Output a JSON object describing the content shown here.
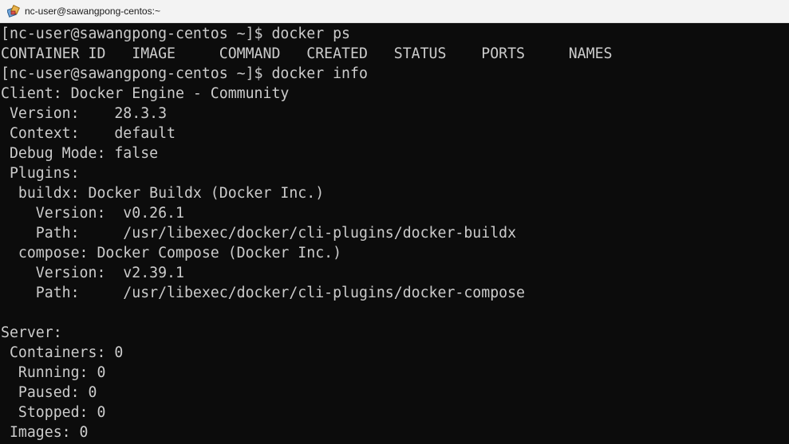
{
  "window": {
    "title": "nc-user@sawangpong-centos:~",
    "icon": "putty-terminal-icon"
  },
  "terminal": {
    "lines": [
      "[nc-user@sawangpong-centos ~]$ docker ps",
      "CONTAINER ID   IMAGE     COMMAND   CREATED   STATUS    PORTS     NAMES",
      "[nc-user@sawangpong-centos ~]$ docker info",
      "Client: Docker Engine - Community",
      " Version:    28.3.3",
      " Context:    default",
      " Debug Mode: false",
      " Plugins:",
      "  buildx: Docker Buildx (Docker Inc.)",
      "    Version:  v0.26.1",
      "    Path:     /usr/libexec/docker/cli-plugins/docker-buildx",
      "  compose: Docker Compose (Docker Inc.)",
      "    Version:  v2.39.1",
      "    Path:     /usr/libexec/docker/cli-plugins/docker-compose",
      "",
      "Server:",
      " Containers: 0",
      "  Running: 0",
      "  Paused: 0",
      "  Stopped: 0",
      " Images: 0"
    ]
  },
  "colors": {
    "terminal_background": "#0c0c0c",
    "terminal_foreground": "#cccccc",
    "titlebar_background": "#f3f3f3"
  }
}
